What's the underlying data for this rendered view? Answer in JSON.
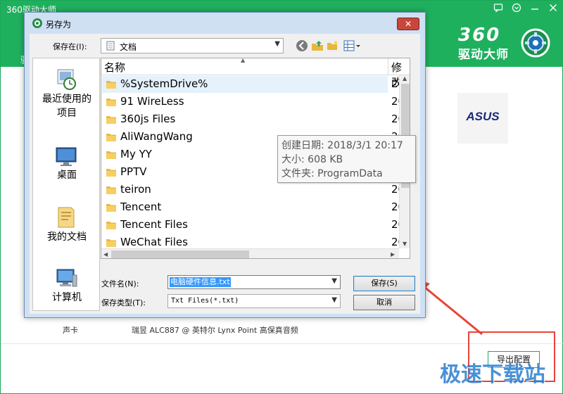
{
  "app": {
    "title": "360驱动大师",
    "left_tab_fragment": "驱",
    "logo_number": "360",
    "logo_name": "驱动大师",
    "window_controls": [
      "feedback-icon",
      "menu-icon",
      "minimize-icon",
      "close-icon"
    ],
    "brand_logo_text": "ASUS",
    "hardware_row": {
      "label": "声卡",
      "value": "瑞昱 ALC887 @ 英特尔 Lynx Point  高保真音频"
    },
    "export_button": "导出配置",
    "watermark": "极速下载站",
    "colors": {
      "brand_green": "#1fb05e",
      "annotation_red": "#e8443a"
    }
  },
  "dialog": {
    "title": "另存为",
    "close_label": "✕",
    "save_in_label": "保存在(I):",
    "save_in_value": "文档",
    "toolbar_icons": [
      "back-icon",
      "up-folder-icon",
      "new-folder-icon",
      "view-menu-icon"
    ],
    "places": [
      {
        "label_line1": "最近使用的",
        "label_line2": "项目",
        "icon": "recent-items-icon"
      },
      {
        "label_line1": "桌面",
        "label_line2": "",
        "icon": "desktop-icon"
      },
      {
        "label_line1": "我的文档",
        "label_line2": "",
        "icon": "documents-icon"
      },
      {
        "label_line1": "计算机",
        "label_line2": "",
        "icon": "computer-icon"
      }
    ],
    "columns": {
      "name": "名称",
      "modified": "修改"
    },
    "files": [
      {
        "name": "%SystemDrive%",
        "date": "20"
      },
      {
        "name": "91 WireLess",
        "date": "20"
      },
      {
        "name": "360js Files",
        "date": "20"
      },
      {
        "name": "AliWangWang",
        "date": "20"
      },
      {
        "name": "My YY",
        "date": "20"
      },
      {
        "name": "PPTV",
        "date": "20"
      },
      {
        "name": "teiron",
        "date": "20"
      },
      {
        "name": "Tencent",
        "date": "20"
      },
      {
        "name": "Tencent Files",
        "date": "20"
      },
      {
        "name": "WeChat Files",
        "date": "20"
      }
    ],
    "tooltip": {
      "created": "创建日期: 2018/3/1 20:17",
      "size": "大小: 608 KB",
      "folder": "文件夹: ProgramData"
    },
    "filename_label": "文件名(N):",
    "filename_value": "电脑硬件信息.txt",
    "filetype_label": "保存类型(T):",
    "filetype_value": "Txt Files(*.txt)",
    "save_button": "保存(S)",
    "cancel_button": "取消"
  }
}
